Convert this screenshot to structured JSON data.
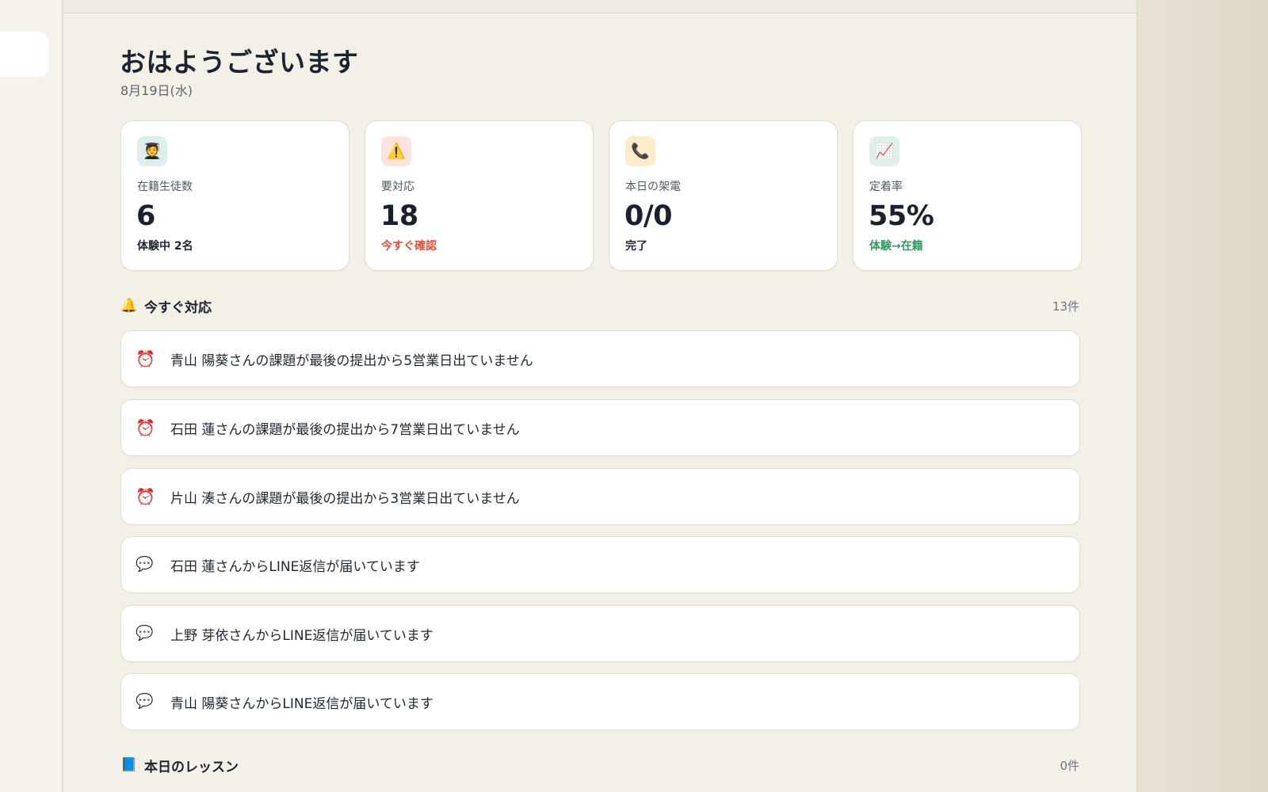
{
  "header": {
    "greeting": "おはようございます",
    "date": "8月19日(水)"
  },
  "stats": [
    {
      "icon": "graduate-icon",
      "glyph": "🧑‍🎓",
      "label": "在籍生徒数",
      "value": "6",
      "sub": "体験中 2名",
      "sub_color": "#1f2733",
      "icon_bg": "#dcefee"
    },
    {
      "icon": "warning-icon",
      "glyph": "⚠️",
      "label": "要対応",
      "value": "18",
      "sub": "今すぐ確認",
      "sub_color": "#e0503a",
      "icon_bg": "#fde3dd"
    },
    {
      "icon": "phone-icon",
      "glyph": "📞",
      "label": "本日の架電",
      "value": "0/0",
      "sub": "完了",
      "sub_color": "#1f2733",
      "icon_bg": "#fdebc9"
    },
    {
      "icon": "chart-up-icon",
      "glyph": "📈",
      "label": "定着率",
      "value": "55%",
      "sub": "体験→在籍",
      "sub_color": "#2e9a5f",
      "icon_bg": "#dff0e6"
    }
  ],
  "urgent": {
    "icon": "bell-icon",
    "glyph": "🔔",
    "title": "今すぐ対応",
    "count": "13件",
    "items": [
      {
        "type": "alarm",
        "icon": "alarm-clock-icon",
        "glyph": "⏰",
        "text": "青山 陽葵さんの課題が最後の提出から5営業日出ていません"
      },
      {
        "type": "alarm",
        "icon": "alarm-clock-icon",
        "glyph": "⏰",
        "text": "石田 蓮さんの課題が最後の提出から7営業日出ていません"
      },
      {
        "type": "alarm",
        "icon": "alarm-clock-icon",
        "glyph": "⏰",
        "text": "片山 湊さんの課題が最後の提出から3営業日出ていません"
      },
      {
        "type": "chat",
        "icon": "speech-bubble-icon",
        "glyph": "💬",
        "text": "石田 蓮さんからLINE返信が届いています"
      },
      {
        "type": "chat",
        "icon": "speech-bubble-icon",
        "glyph": "💬",
        "text": "上野 芽依さんからLINE返信が届いています"
      },
      {
        "type": "chat",
        "icon": "speech-bubble-icon",
        "glyph": "💬",
        "text": "青山 陽葵さんからLINE返信が届いています"
      }
    ]
  },
  "lessons": {
    "icon": "book-icon",
    "glyph": "📘",
    "title": "本日のレッスン",
    "count": "0件"
  }
}
